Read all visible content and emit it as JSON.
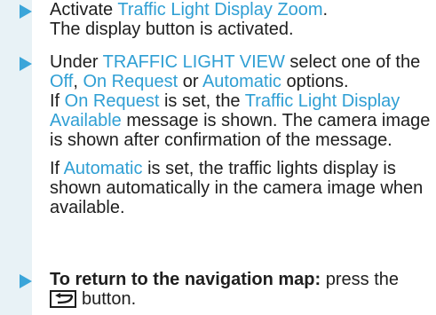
{
  "steps": [
    {
      "prefix": "Activate ",
      "link": "Traffic Light Display Zoom",
      "suffix": ".",
      "result": "The display button is activated."
    },
    {
      "line1_prefix": "Under ",
      "view_name": "TRAFFIC LIGHT VIEW",
      "line1_suffix": " select one of the",
      "opt_off": "Off",
      "sep1": ", ",
      "opt_on_request": "On Request",
      "sep2": " or ",
      "opt_automatic": "Automatic",
      "sep3": " options.",
      "p1_prefix": "If ",
      "p1_option": "On Request",
      "p1_mid": " is set, the ",
      "p1_message": "Traffic Light Display Available",
      "p1_suffix": " message is shown. The camera image is shown after confirmation of the message.",
      "p2_prefix": "If ",
      "p2_option": "Automatic",
      "p2_suffix": " is set, the traffic lights display is shown automatically in the camera image when available."
    },
    {
      "bold": "To return to the navigation map:",
      "text_after_bold": " press the",
      "button_text": "button."
    }
  ],
  "colors": {
    "highlight": "#2f9fd4",
    "arrow": "#3aa5d9",
    "panel": "#e8f2f6"
  }
}
